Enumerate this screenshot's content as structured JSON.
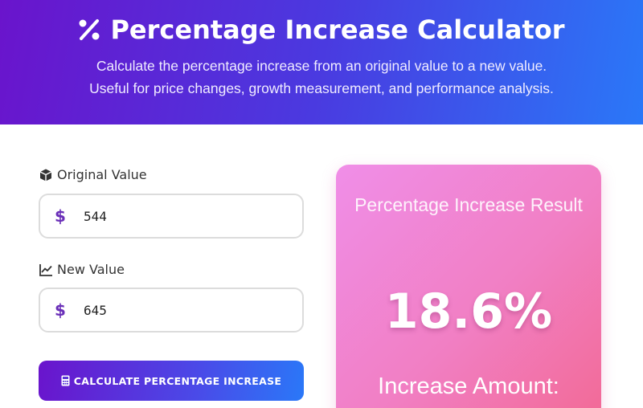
{
  "header": {
    "title": "Percentage Increase Calculator",
    "title_icon": "percent-icon",
    "subtitle_line1": "Calculate the percentage increase from an original value to a new value.",
    "subtitle_line2": "Useful for price changes, growth measurement, and performance analysis.",
    "gradient_start": "#6a14cc",
    "gradient_end": "#2a78f8"
  },
  "form": {
    "original": {
      "label": "Original Value",
      "icon": "cube-icon",
      "prefix": "$",
      "value": "544",
      "prefix_icon": "dollar-icon"
    },
    "new": {
      "label": "New Value",
      "icon": "chart-line-icon",
      "prefix": "$",
      "value": "645",
      "prefix_icon": "dollar-icon"
    },
    "calculate_button": {
      "label": "CALCULATE PERCENTAGE INCREASE",
      "icon": "calculator-icon"
    }
  },
  "result": {
    "title": "Percentage Increase Result",
    "value": "18.6%",
    "increase_label": "Increase Amount:",
    "card_color_start": "#f08ee8",
    "card_color_end": "#f26a96"
  }
}
